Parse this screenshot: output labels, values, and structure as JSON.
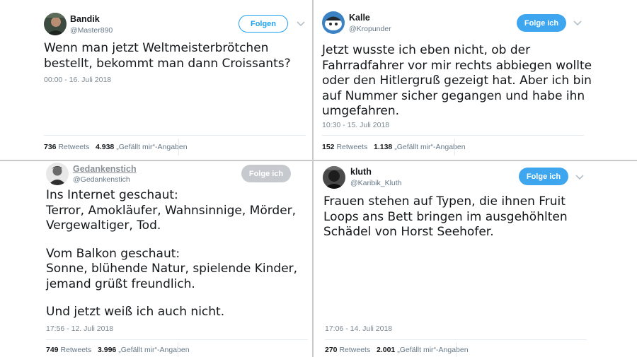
{
  "tweets": [
    {
      "name": "Bandik",
      "handle": "@Master890",
      "button": "Folgen",
      "lines": [
        "Wenn man jetzt Weltmeisterbrötchen",
        "bestellt, bekommt man dann Croissants?"
      ],
      "time": "00:00 - 16. Juli 2018",
      "retweets": "736",
      "retweets_label": "Retweets",
      "likes": "4.938",
      "likes_label": "„Gefällt mir“-Angaben"
    },
    {
      "name": "Kalle",
      "handle": "@Kropunder",
      "button": "Folge ich",
      "lines": [
        "Jetzt wusste ich eben nicht, ob der",
        "Fahrradfahrer vor mir rechts abbiegen wollte",
        "oder den Hitlergruß gezeigt hat. Aber ich bin",
        "auf Nummer sicher gegangen und habe ihn",
        "umgefahren."
      ],
      "time": "10:30 - 15. Juli 2018",
      "retweets": "152",
      "retweets_label": "Retweets",
      "likes": "1.138",
      "likes_label": "„Gefällt mir“-Angaben"
    },
    {
      "name": "Gedankenstich",
      "handle": "@Gedankenstich",
      "button": "Folge ich",
      "lines": [
        "Ins Internet geschaut:",
        "Terror, Amokläufer, Wahnsinnige, Mörder,",
        "Vergewaltiger, Tod.",
        "",
        "Vom Balkon geschaut:",
        "Sonne, blühende Natur, spielende Kinder,",
        "jemand grüßt freundlich.",
        "",
        "Und jetzt weiß ich auch nicht."
      ],
      "time": "17:56 - 12. Juli 2018",
      "retweets": "749",
      "retweets_label": "Retweets",
      "likes": "3.996",
      "likes_label": "„Gefällt mir“-Angaben"
    },
    {
      "name": "kluth",
      "handle": "@Karibik_Kluth",
      "button": "Folge ich",
      "lines": [
        "Frauen stehen auf Typen, die ihnen Fruit",
        "Loops ans Bett bringen im ausgehöhlten",
        "Schädel von Horst Seehofer."
      ],
      "time": "17:06 - 14. Juli 2018",
      "retweets": "270",
      "retweets_label": "Retweets",
      "likes": "2.001",
      "likes_label": "„Gefällt mir“-Angaben"
    }
  ],
  "icons": {
    "more": "chevron-down-icon"
  },
  "colors": {
    "accent": "#1da1f2",
    "following": "#3ea6ef",
    "disabled": "#c6cacf",
    "divider": "#c9c9c9"
  }
}
